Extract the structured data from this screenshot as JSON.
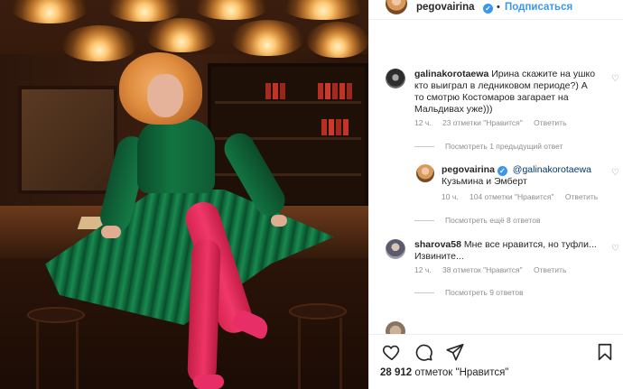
{
  "post": {
    "author": "pegovairina",
    "follow_label": "Подписаться",
    "dot": "•"
  },
  "comments": [
    {
      "username": "galinakorotaewa",
      "text": "Ирина скажите на ушко кто выиграл в ледниковом периоде?) А то смотрю Костомаров загарает на Мальдивах уже)))",
      "time": "12 ч.",
      "likes": "23 отметки \"Нравится\"",
      "reply": "Ответить",
      "view_replies": "Посмотреть 1 предыдущий ответ"
    },
    {
      "username": "pegovairina",
      "mention": "@galinakorotaewa",
      "text": "Кузьмина  и Эмберт",
      "time": "10 ч.",
      "likes": "104 отметки \"Нравится\"",
      "reply": "Ответить",
      "view_replies": "Посмотреть ещё 8 ответов"
    },
    {
      "username": "sharova58",
      "text": "Мне все нравится, но туфли... Извините...",
      "time": "12 ч.",
      "likes": "38 отметок \"Нравится\"",
      "reply": "Ответить",
      "view_replies": "Посмотреть 9 ответов"
    }
  ],
  "footer": {
    "likes_count": "28 912",
    "likes_label": "отметок \"Нравится\""
  },
  "icons": {
    "like": "heart-icon",
    "comment": "comment-icon",
    "share": "share-icon",
    "save": "bookmark-icon"
  },
  "colors": {
    "accent": "#3897f0",
    "meta": "#8e8e8e",
    "text": "#262626"
  }
}
